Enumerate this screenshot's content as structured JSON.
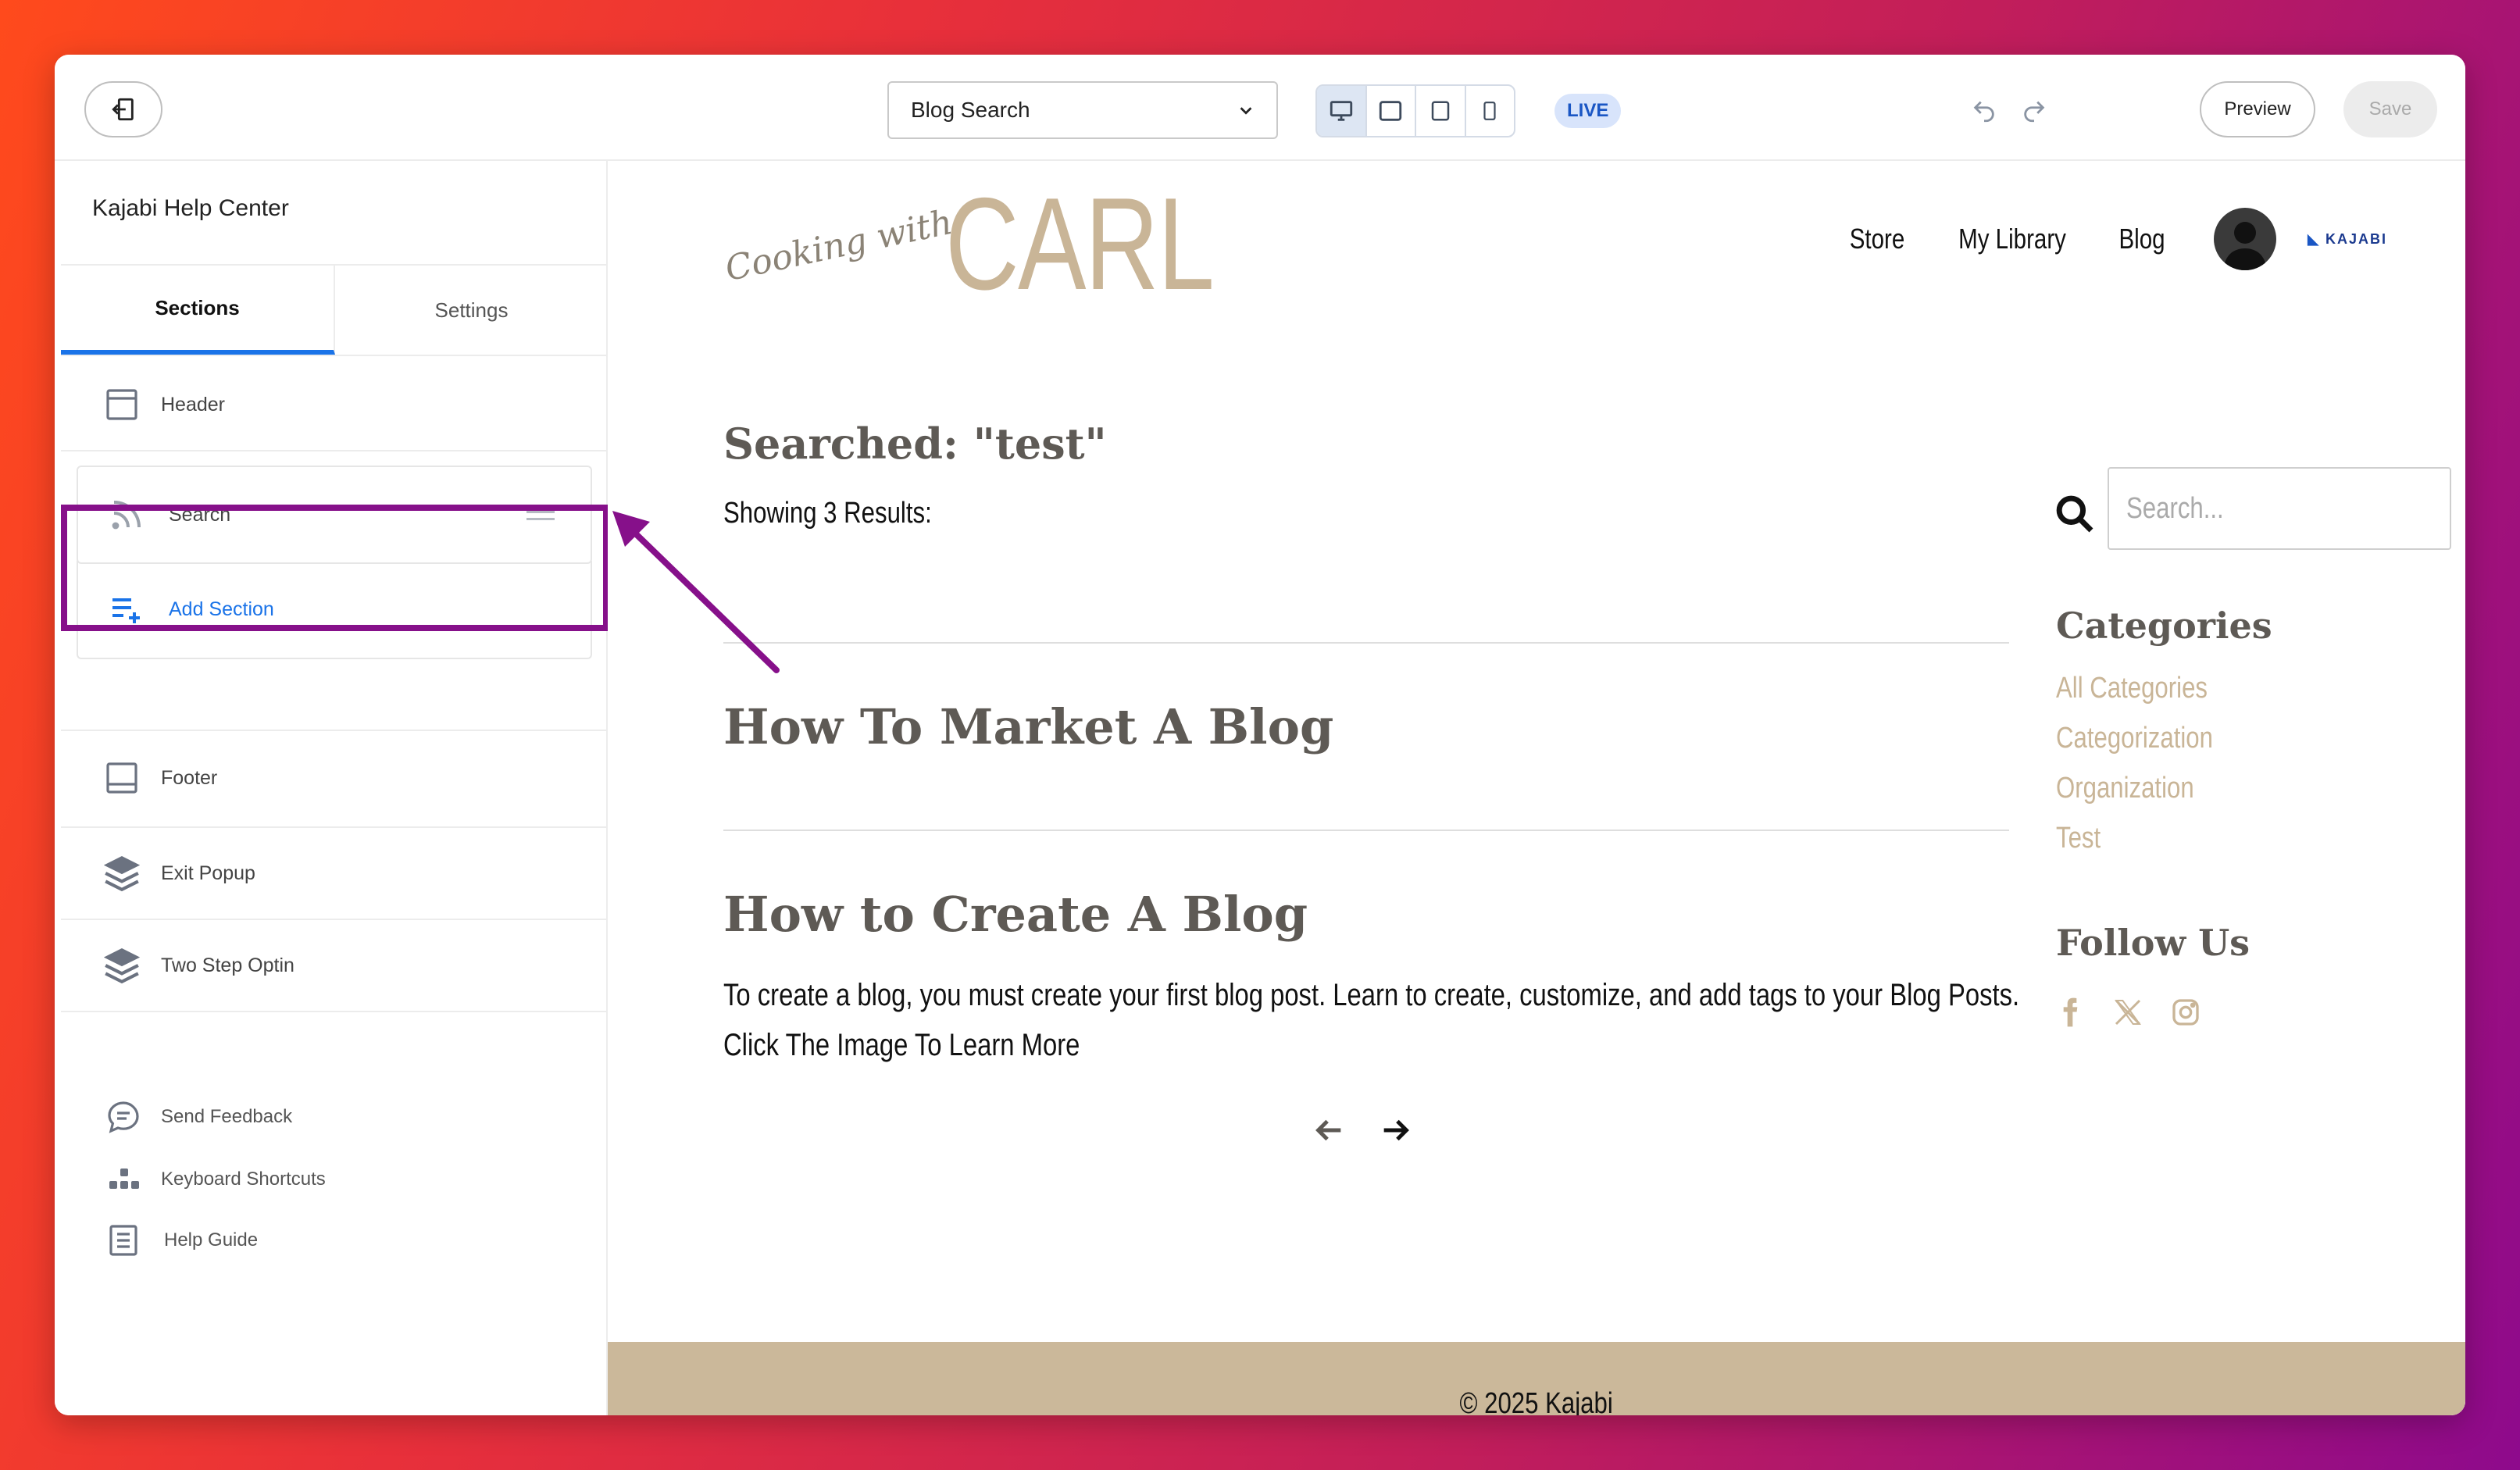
{
  "editor": {
    "page_select": "Blog Search",
    "live_badge": "LIVE",
    "preview_label": "Preview",
    "save_label": "Save",
    "accent": "#1a73e8"
  },
  "sidebar": {
    "title": "Kajabi Help Center",
    "tabs": [
      "Sections",
      "Settings"
    ],
    "items": {
      "header": "Header",
      "search": "Search",
      "add_section": "Add Section",
      "footer": "Footer",
      "exit_popup": "Exit Popup",
      "two_step": "Two Step Optin"
    },
    "footer_links": {
      "feedback": "Send Feedback",
      "shortcuts": "Keyboard Shortcuts",
      "help": "Help Guide"
    },
    "highlight_color": "#86108a"
  },
  "site": {
    "logo_script": "Cooking with",
    "logo_name": "CARL",
    "nav": [
      "Store",
      "My Library",
      "Blog"
    ],
    "brand": "KAJABI",
    "search_title": "Searched: \"test\"",
    "results_count": "Showing 3 Results:",
    "posts": [
      {
        "title": "How To Market A Blog"
      },
      {
        "title": "How to Create A Blog",
        "excerpt_1": "To create a blog, you must create your first blog post. Learn to create, customize, and add tags to your Blog Posts.",
        "excerpt_2": "Click The Image  To Learn More"
      }
    ],
    "search_placeholder": "Search...",
    "categories_heading": "Categories",
    "categories": [
      "All Categories",
      "Categorization",
      "Organization",
      "Test"
    ],
    "follow_heading": "Follow Us",
    "social_icons": [
      "facebook-icon",
      "x-icon",
      "instagram-icon"
    ],
    "footer_text": "© 2025 Kajabi",
    "brand_color": "#c9b597"
  }
}
